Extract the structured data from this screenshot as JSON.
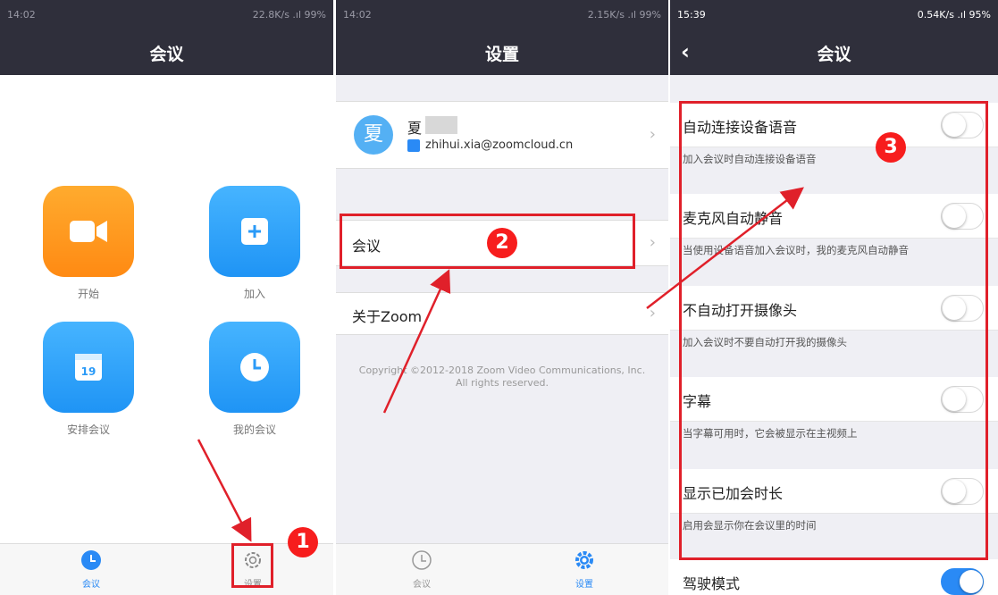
{
  "panel1": {
    "status": {
      "time": "14:02",
      "right": "22.8K/s .ıl 99%"
    },
    "title": "会议",
    "tiles": [
      {
        "label": "开始",
        "icon": "video-camera-icon"
      },
      {
        "label": "加入",
        "icon": "plus-icon"
      },
      {
        "label": "安排会议",
        "icon": "calendar-icon",
        "day": "19"
      },
      {
        "label": "我的会议",
        "icon": "clock-icon"
      }
    ],
    "tabs": [
      {
        "label": "会议",
        "icon": "clock-icon",
        "active": true
      },
      {
        "label": "设置",
        "icon": "gear-icon",
        "active": false
      }
    ]
  },
  "panel2": {
    "status": {
      "time": "14:02",
      "right": "2.15K/s .ıl 99%"
    },
    "title": "设置",
    "profile": {
      "avatar_char": "夏",
      "name": "夏",
      "email": "zhihui.xia@zoomcloud.cn"
    },
    "rows": [
      {
        "label": "会议"
      },
      {
        "label": "关于Zoom"
      }
    ],
    "copyright": [
      "Copyright ©2012-2018 Zoom Video Communications, Inc.",
      "All rights reserved."
    ],
    "tabs": [
      {
        "label": "会议",
        "icon": "clock-icon",
        "active": false
      },
      {
        "label": "设置",
        "icon": "gear-icon",
        "active": true
      }
    ]
  },
  "panel3": {
    "status": {
      "time": "15:39",
      "right": "0.54K/s .ıl 95%"
    },
    "title": "会议",
    "settings": [
      {
        "title": "自动连接设备语音",
        "desc": "加入会议时自动连接设备语音",
        "on": false
      },
      {
        "title": "麦克风自动静音",
        "desc": "当使用设备语音加入会议时，我的麦克风自动静音",
        "on": false
      },
      {
        "title": "不自动打开摄像头",
        "desc": "加入会议时不要自动打开我的摄像头",
        "on": false
      },
      {
        "title": "字幕",
        "desc": "当字幕可用时，它会被显示在主视频上",
        "on": false
      },
      {
        "title": "显示已加会时长",
        "desc": "启用会显示你在会议里的时间",
        "on": false
      },
      {
        "title": "驾驶模式",
        "desc": "",
        "on": true
      }
    ]
  },
  "annotations": {
    "steps": [
      "1",
      "2",
      "3"
    ],
    "color": "#e0202a"
  }
}
